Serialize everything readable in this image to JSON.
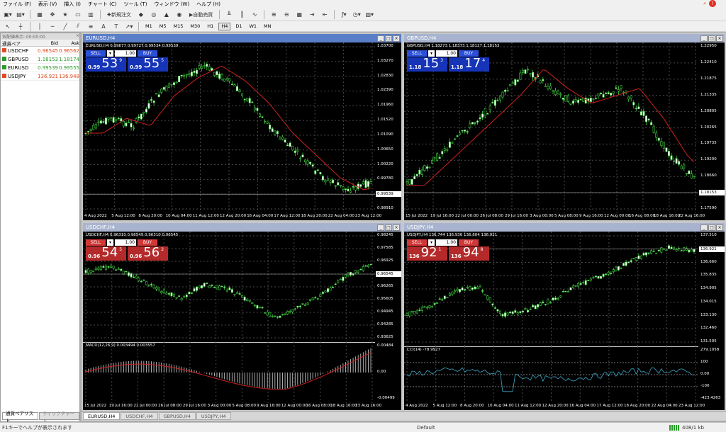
{
  "menu": [
    "ファイル (F)",
    "表示 (V)",
    "挿入 (I)",
    "チャート (C)",
    "ツール (T)",
    "ウィンドウ (W)",
    "ヘルプ (H)"
  ],
  "toolbar": {
    "new_order": "新規注文",
    "auto_trading": "自動売買",
    "timeframes": [
      "M1",
      "M5",
      "M15",
      "M30",
      "H1",
      "H4",
      "D1",
      "W1",
      "MN"
    ],
    "active_timeframe": "H4"
  },
  "market_watch": {
    "title": "気配値表示: 00:00:00",
    "headers": [
      "通貨ペア",
      "Bid",
      "Ask"
    ],
    "rows": [
      {
        "symbol": "USDCHF",
        "bid": "0.96545",
        "ask": "0.96562",
        "color": "#e04a20"
      },
      {
        "symbol": "GBPUSD",
        "bid": "1.18153",
        "ask": "1.18174",
        "color": "#2a9a2a"
      },
      {
        "symbol": "EURUSD",
        "bid": "0.99539",
        "ask": "0.99555",
        "color": "#2a9a2a"
      },
      {
        "symbol": "USDJPY",
        "bid": "136.921",
        "ask": "136.948",
        "color": "#e04a20"
      }
    ],
    "tabs": [
      "通貨ペアリスト",
      "ティックチャート"
    ]
  },
  "windows": [
    {
      "title": "EURUSD,H4",
      "info": "EURUSD,H4  0.99677 0.99727 0.99534 0.99539",
      "theme": "blue",
      "sell": {
        "label": "SELL",
        "small": "0.99",
        "big": "53",
        "sup": "9"
      },
      "buy": {
        "label": "BUY",
        "small": "0.99",
        "big": "55",
        "sup": "5"
      },
      "lot": "1.00",
      "price_labels": [
        "1.03700",
        "1.03270",
        "1.02830",
        "1.02390",
        "1.01960",
        "1.01520",
        "1.01090",
        "1.00650",
        "1.00220",
        "0.99780",
        "0.99350",
        "0.98910"
      ],
      "current": "0.99539",
      "time_labels": [
        "4 Aug 2022",
        "5 Aug 12:00",
        "8 Aug 20:00",
        "10 Aug 04:00",
        "11 Aug 12:00",
        "12 Aug 20:00",
        "16 Aug 04:00",
        "17 Aug 12:00",
        "18 Aug 20:00",
        "22 Aug 04:00",
        "23 Aug 12:00"
      ]
    },
    {
      "title": "GBPUSD,H4",
      "info": "GBPUSD,H4  1.18273 1.18373 1.18127 1.18153",
      "theme": "blue",
      "sell": {
        "label": "SELL",
        "small": "1.18",
        "big": "15",
        "sup": "3"
      },
      "buy": {
        "label": "BUY",
        "small": "1.18",
        "big": "17",
        "sup": "4"
      },
      "lot": "1.00",
      "price_labels": [
        "1.22950",
        "1.22410",
        "1.21875",
        "1.21335",
        "1.20805",
        "1.20265",
        "1.19735",
        "1.19200",
        "1.18660",
        "1.18153",
        "1.17590"
      ],
      "current": "1.18153",
      "time_labels": [
        "15 Jul 2022",
        "19 Jul 16:00",
        "22 Jul 00:00",
        "26 Jul 08:00",
        "29 Jul 16:00",
        "3 Aug 00:00",
        "5 Aug 08:00",
        "9 Aug 16:00",
        "12 Aug 00:00",
        "16 Aug 08:00",
        "18 Aug 16:00",
        "22 Aug 16:00"
      ]
    },
    {
      "title": "USDCHF,H4",
      "info": "USDCHF,H4  0.96310 0.96549 0.96310 0.96545",
      "theme": "red",
      "sell": {
        "label": "SELL",
        "small": "0.96",
        "big": "54",
        "sup": "5"
      },
      "buy": {
        "label": "BUY",
        "small": "0.96",
        "big": "56",
        "sup": "2"
      },
      "lot": "1.00",
      "price_labels": [
        "0.98245",
        "0.97585",
        "0.96925",
        "0.96545",
        "0.96265",
        "0.95605",
        "0.94945",
        "0.94285",
        "0.93625"
      ],
      "current": "0.96545",
      "indicator": "MACD(12,26,9) 0.003494 0.003557",
      "indicator_labels": [
        "0.00484",
        "0.00",
        "-0.00499"
      ],
      "time_labels": [
        "15 Jul 2022",
        "19 Jul 16:00",
        "22 Jul 00:00",
        "26 Jul 08:00",
        "29 Jul 16:00",
        "3 Aug 00:00",
        "5 Aug 08:00",
        "9 Aug 16:00",
        "12 Aug 00:00",
        "16 Aug 08:00",
        "18 Aug 16:00",
        "23 Aug 16:00"
      ]
    },
    {
      "title": "USDJPY,H4",
      "info": "USDJPY,H4  136.744 136.936 136.604 136.921",
      "theme": "red",
      "sell": {
        "label": "SELL",
        "small": "136",
        "big": "92",
        "sup": "1"
      },
      "buy": {
        "label": "BUY",
        "small": "136",
        "big": "94",
        "sup": "8"
      },
      "lot": "1.00",
      "price_labels": [
        "137.510",
        "136.921",
        "136.660",
        "135.835",
        "134.905",
        "134.015",
        "133.130",
        "132.460",
        "131.505"
      ],
      "current": "136.921",
      "indicator": "CCI(14) -78.9927",
      "indicator_labels": [
        "279.1058",
        "100",
        "0.00",
        "-100",
        "-423.4263"
      ],
      "time_labels": [
        "4 Aug 2022",
        "5 Aug 12:00",
        "8 Aug 20:00",
        "10 Aug 04:00",
        "11 Aug 12:00",
        "12 Aug 20:00",
        "16 Aug 04:00",
        "17 Aug 12:00",
        "18 Aug 20:00",
        "22 Aug 04:00",
        "23 Aug 12:00"
      ]
    }
  ],
  "chart_tabs": [
    "EURUSD,H4",
    "USDCHF,H4",
    "GBPUSD,H4",
    "USDJPY,H4"
  ],
  "status": {
    "help": "F1キーでヘルプが表示されます",
    "profile": "Default",
    "traffic": "408/1 kb"
  }
}
